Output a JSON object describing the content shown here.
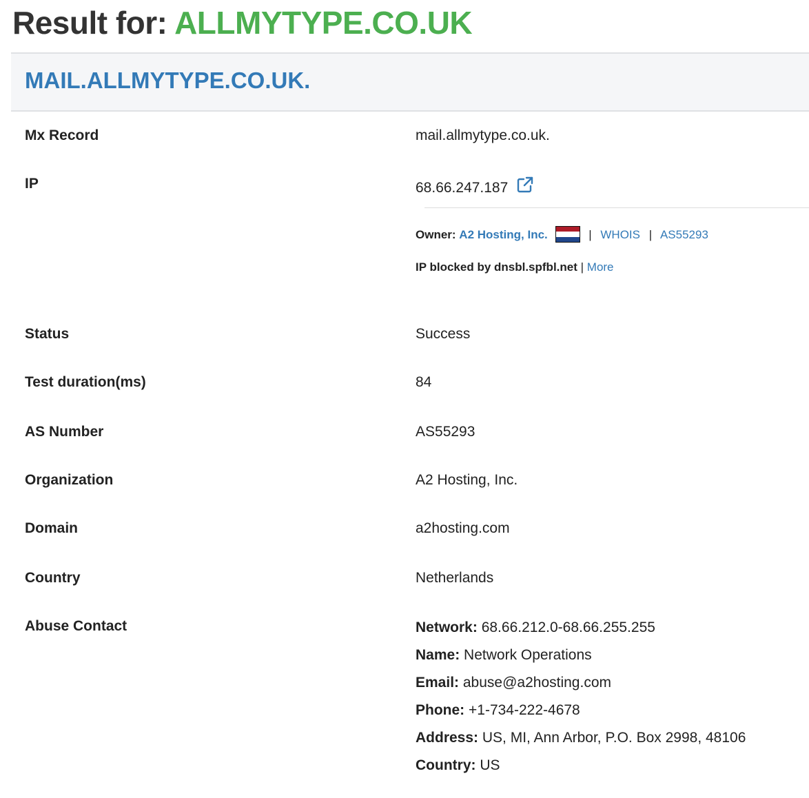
{
  "result": {
    "prefix": "Result for:",
    "domain": "ALLMYTYPE.CO.UK"
  },
  "card": {
    "host": "MAIL.ALLMYTYPE.CO.UK."
  },
  "rows": {
    "mx": {
      "label": "Mx Record",
      "value": "mail.allmytype.co.uk."
    },
    "ip": {
      "label": "IP",
      "value": "68.66.247.187"
    },
    "status": {
      "label": "Status",
      "value": "Success"
    },
    "duration": {
      "label": "Test duration(ms)",
      "value": "84"
    },
    "as_number": {
      "label": "AS Number",
      "value": "AS55293"
    },
    "organization": {
      "label": "Organization",
      "value": "A2 Hosting, Inc."
    },
    "domain": {
      "label": "Domain",
      "value": "a2hosting.com"
    },
    "country": {
      "label": "Country",
      "value": "Netherlands"
    },
    "abuse": {
      "label": "Abuse Contact"
    }
  },
  "owner": {
    "label": "Owner:",
    "name": "A2 Hosting, Inc.",
    "flag_icon": "netherlands-flag-icon",
    "whois": "WHOIS",
    "asn": "AS55293",
    "separator": "|"
  },
  "blocked": {
    "text": "IP blocked by dnsbl.spfbl.net",
    "separator": "|",
    "more": "More"
  },
  "abuse_contact": {
    "network": {
      "key": "Network:",
      "value": "68.66.212.0-68.66.255.255"
    },
    "name": {
      "key": "Name:",
      "value": "Network Operations"
    },
    "email": {
      "key": "Email:",
      "value": "abuse@a2hosting.com"
    },
    "phone": {
      "key": "Phone:",
      "value": "+1-734-222-4678"
    },
    "address": {
      "key": "Address:",
      "value": "US, MI, Ann Arbor, P.O. Box 2998, 48106"
    },
    "country": {
      "key": "Country:",
      "value": "US"
    }
  },
  "icons": {
    "external_link": "external-link-icon"
  },
  "colors": {
    "domain_green": "#4caf50",
    "link_blue": "#337ab7",
    "header_bg": "#f5f6f8"
  }
}
